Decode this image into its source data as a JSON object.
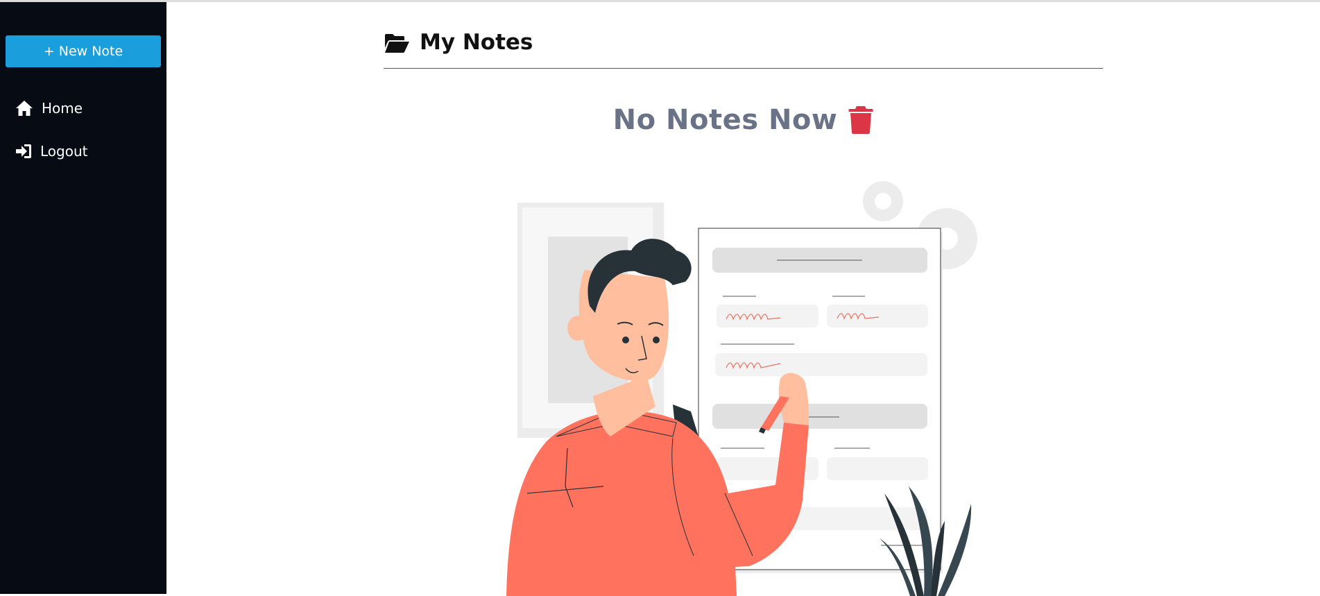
{
  "sidebar": {
    "new_note_label": "+ New Note",
    "items": [
      {
        "label": "Home",
        "icon": "home-icon"
      },
      {
        "label": "Logout",
        "icon": "sign-in-icon"
      }
    ]
  },
  "header": {
    "title": "My Notes",
    "icon": "folder-open-icon"
  },
  "empty_state": {
    "message": "No Notes Now",
    "icon": "trash-icon",
    "illustration": "person-writing-on-form-illustration"
  },
  "colors": {
    "sidebar_bg": "#060b14",
    "accent": "#1a9fdc",
    "empty_text": "#6a7287",
    "trash": "#dc3545",
    "shirt": "#ff725e"
  }
}
